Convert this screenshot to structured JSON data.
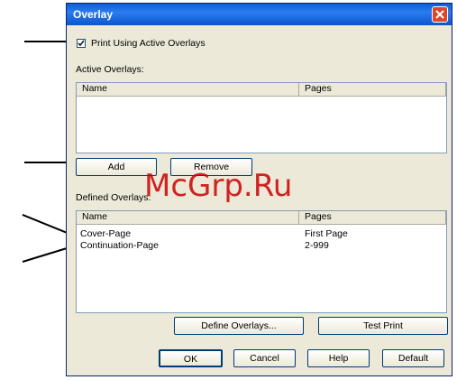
{
  "window": {
    "title": "Overlay"
  },
  "print_overlays_checkbox": {
    "label": "Print Using Active Overlays",
    "checked": true
  },
  "active_overlays": {
    "label": "Active Overlays:",
    "columns": [
      "Name",
      "Pages"
    ],
    "rows": []
  },
  "buttons": {
    "add": "Add",
    "remove": "Remove",
    "define_overlays": "Define Overlays...",
    "test_print": "Test Print",
    "ok": "OK",
    "cancel": "Cancel",
    "help": "Help",
    "default": "Default"
  },
  "defined_overlays": {
    "label": "Defined Overlays:",
    "columns": [
      "Name",
      "Pages"
    ],
    "rows": [
      {
        "name": "Cover-Page",
        "pages": "First Page"
      },
      {
        "name": "Continuation-Page",
        "pages": "2-999"
      }
    ]
  },
  "watermark": "McGrp.Ru",
  "colors": {
    "titlebar": "#0a5fd8",
    "dialog_bg": "#ece9d8",
    "close_button": "#d9482c",
    "watermark": "#cc0000"
  }
}
